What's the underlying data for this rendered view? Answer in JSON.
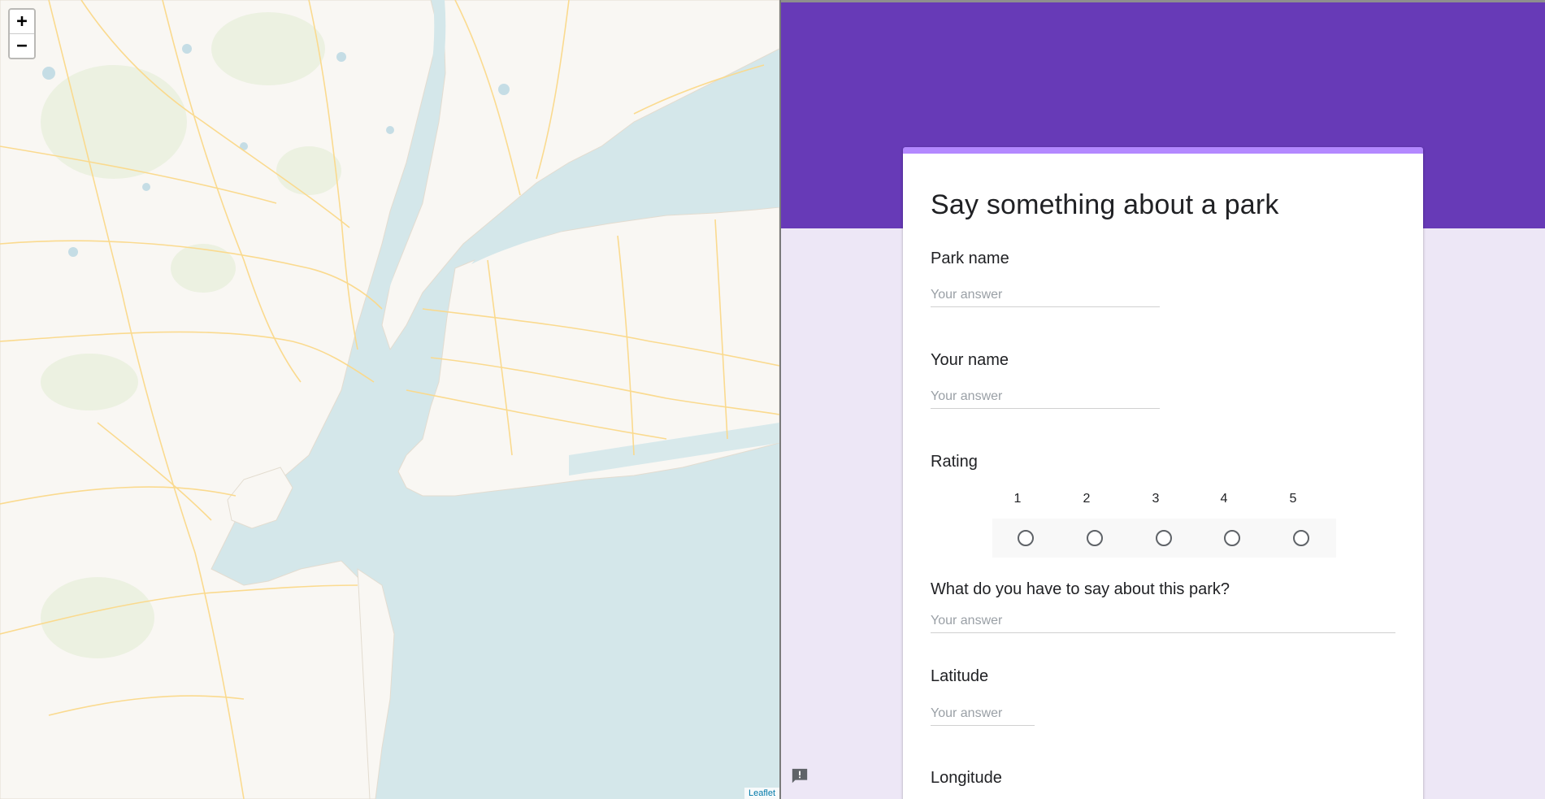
{
  "map": {
    "zoom_in_label": "+",
    "zoom_out_label": "−",
    "attribution": "Leaflet",
    "colors": {
      "water": "#d4e7ea",
      "land": "#f9f7f3",
      "roads": "#fbd98a"
    }
  },
  "form": {
    "title": "Say something about a park",
    "accent_color": "#673ab7",
    "background_color": "#ede7f6",
    "questions": {
      "park_name": {
        "label": "Park name",
        "placeholder": "Your answer"
      },
      "your_name": {
        "label": "Your name",
        "placeholder": "Your answer"
      },
      "rating": {
        "label": "Rating",
        "options": [
          "1",
          "2",
          "3",
          "4",
          "5"
        ]
      },
      "comment": {
        "label": "What do you have to say about this park?",
        "placeholder": "Your answer"
      },
      "latitude": {
        "label": "Latitude",
        "placeholder": "Your answer"
      },
      "longitude": {
        "label": "Longitude"
      }
    },
    "feedback_icon": "report-feedback-icon"
  }
}
